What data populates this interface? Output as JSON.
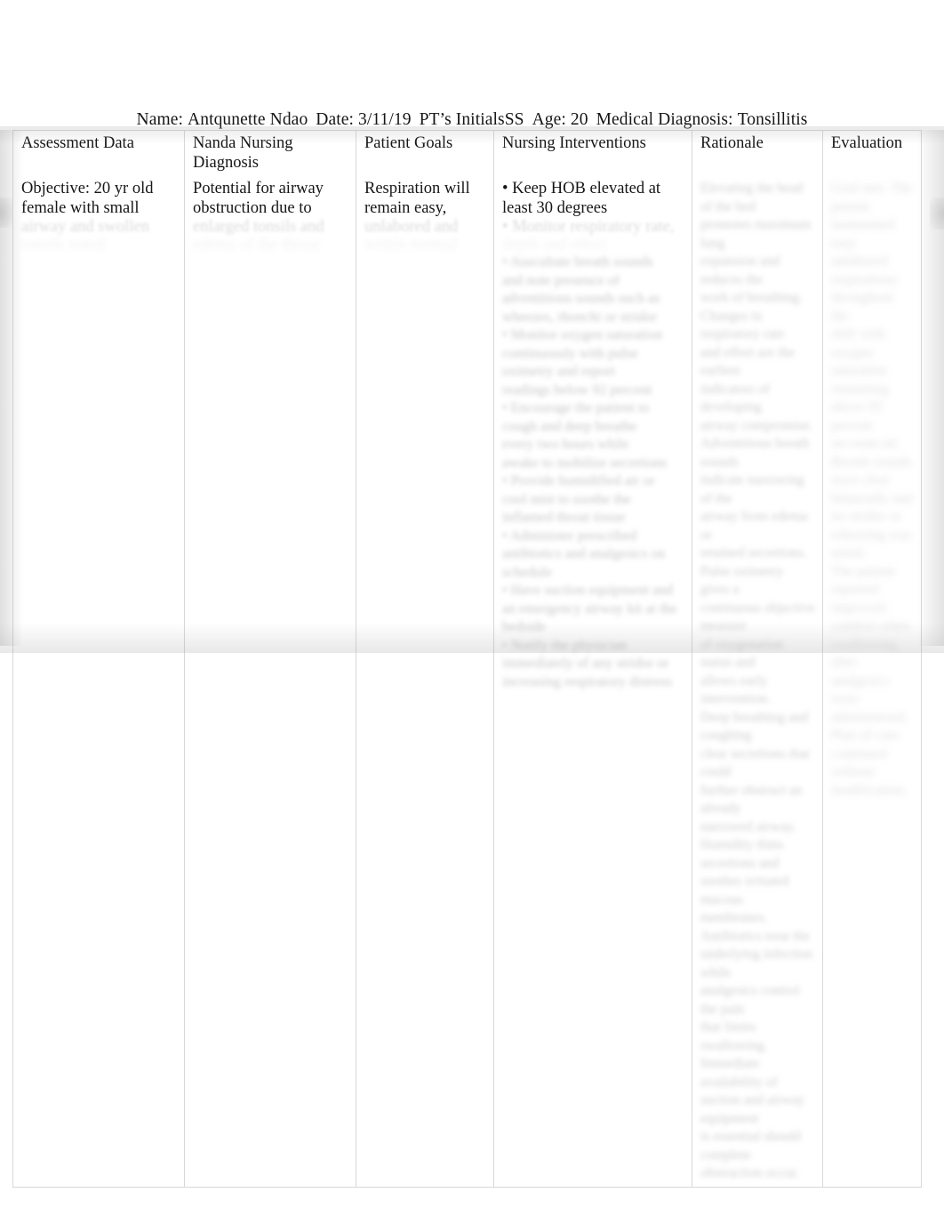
{
  "document": {
    "header": {
      "name_label": "Name:",
      "name_value": "Antqunette Ndao",
      "date_label": "Date:",
      "date_value": "3/11/19",
      "initials_label": "PT’s Initials",
      "initials_value": "SS",
      "age_label": "Age:",
      "age_value": "20",
      "diagnosis_label": "Medical Diagnosis:",
      "diagnosis_value": "Tonsillitis"
    },
    "table": {
      "columns": [
        {
          "header": "Assessment Data"
        },
        {
          "header_line1": "Nanda Nursing",
          "header_line2": "Diagnosis"
        },
        {
          "header": "Patient Goals"
        },
        {
          "header": "Nursing Interventions"
        },
        {
          "header": "Rationale"
        },
        {
          "header": "Evaluation"
        }
      ],
      "row": {
        "assessment_data": {
          "line1": "Objective:  20 yr old",
          "line2": "female with small",
          "line3_faded": "airway and swollen",
          "line4_faded": "tonsils noted"
        },
        "nanda_nursing_diagnosis": {
          "line1": "Potential for airway",
          "line2": "obstruction due to",
          "line3_faded": "enlarged tonsils and",
          "line4_faded": "edema of the throat"
        },
        "patient_goals": {
          "line1": "Respiration will",
          "line2": "remain easy,",
          "line3_faded": "unlabored and",
          "line4_faded": "within normal limits"
        },
        "nursing_interventions": {
          "line1": "• Keep HOB elevated at",
          "line2": "least 30 degrees",
          "line3_faded": "• Monitor respiratory rate,",
          "line4_faded": "depth and effort",
          "blurred_body": [
            "• Auscultate breath sounds",
            "and note presence of",
            "adventitious sounds such as",
            "wheezes, rhonchi or stridor",
            "• Monitor oxygen saturation",
            "continuously with pulse",
            "oximetry and report",
            "readings below 92 percent",
            "• Encourage the patient to",
            "cough and deep breathe",
            "every two hours while",
            "awake to mobilize secretions",
            "• Provide humidified air or",
            "cool mist to soothe the",
            "inflamed throat tissue",
            "• Administer prescribed",
            "antibiotics and analgesics on",
            "schedule",
            "• Have suction equipment and",
            "an emergency airway kit at the",
            "bedside",
            "• Notify the physician",
            "immediately of any stridor or",
            "increasing respiratory distress"
          ]
        },
        "rationale": {
          "blurred_body": [
            "Elevating the head of the bed",
            "promotes maximum lung",
            "expansion and reduces the",
            "work of breathing.",
            "Changes in respiratory rate",
            "and effort are the earliest",
            "indicators of developing",
            "airway compromise.",
            "Adventitious breath sounds",
            "indicate narrowing of the",
            "airway from edema or",
            "retained secretions.",
            "Pulse oximetry gives a",
            "continuous objective measure",
            "of oxygenation status and",
            "allows early intervention.",
            "Deep breathing and coughing",
            "clear secretions that could",
            "further obstruct an already",
            "narrowed airway.",
            "Humidity thins secretions and",
            "soothes irritated mucous",
            "membranes.",
            "Antibiotics treat the",
            "underlying infection while",
            "analgesics control the pain",
            "that limits swallowing.",
            "Immediate availability of",
            "suction and airway equipment",
            "is essential should complete",
            "obstruction occur."
          ]
        },
        "evaluation": {
          "blurred_body": [
            "Goal met. The patient",
            "maintained easy unlabored",
            "respirations throughout the",
            "shift with oxygen saturation",
            "remaining above 95 percent",
            "on room air.",
            "Breath sounds were clear",
            "bilaterally and no stridor or",
            "wheezing was noted.",
            "The patient reported",
            "improved comfort when",
            "swallowing after analgesics",
            "were administered.",
            "Plan of care continued",
            "without modification."
          ]
        }
      }
    }
  }
}
